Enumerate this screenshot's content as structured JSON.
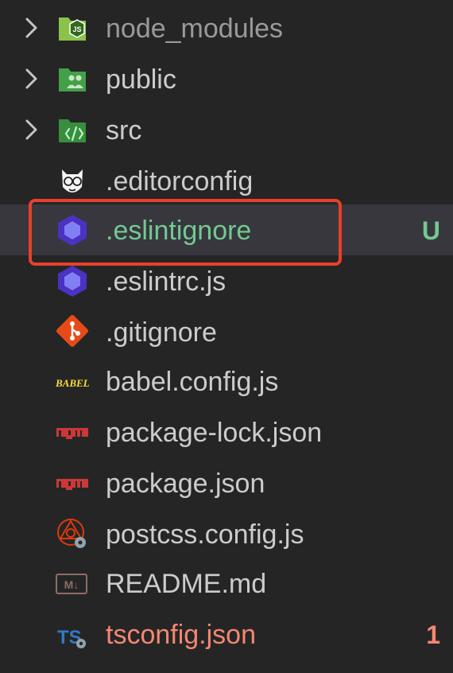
{
  "explorer": {
    "items": [
      {
        "label": "node_modules",
        "icon": "node-modules-folder-icon",
        "expandable": true
      },
      {
        "label": "public",
        "icon": "public-folder-icon",
        "expandable": true
      },
      {
        "label": "src",
        "icon": "src-folder-icon",
        "expandable": true
      },
      {
        "label": ".editorconfig",
        "icon": "editorconfig-icon"
      },
      {
        "label": ".eslintignore",
        "icon": "eslint-icon",
        "badge": "U",
        "status": "untracked",
        "selected": true
      },
      {
        "label": ".eslintrc.js",
        "icon": "eslint-icon"
      },
      {
        "label": ".gitignore",
        "icon": "git-icon"
      },
      {
        "label": "babel.config.js",
        "icon": "babel-icon",
        "icon_text": "BABEL"
      },
      {
        "label": "package-lock.json",
        "icon": "npm-icon"
      },
      {
        "label": "package.json",
        "icon": "npm-icon"
      },
      {
        "label": "postcss.config.js",
        "icon": "postcss-icon"
      },
      {
        "label": "README.md",
        "icon": "markdown-icon",
        "icon_text": "M↓"
      },
      {
        "label": "tsconfig.json",
        "icon": "typescript-icon",
        "icon_text": "TS",
        "badge": "1",
        "status": "error"
      }
    ]
  },
  "colors": {
    "background": "#252526",
    "selected_row": "#37373d",
    "text": "#cccccc",
    "dim_text": "#9a9a9a",
    "untracked": "#73c991",
    "error": "#f48771",
    "highlight_box": "#e8402a"
  }
}
